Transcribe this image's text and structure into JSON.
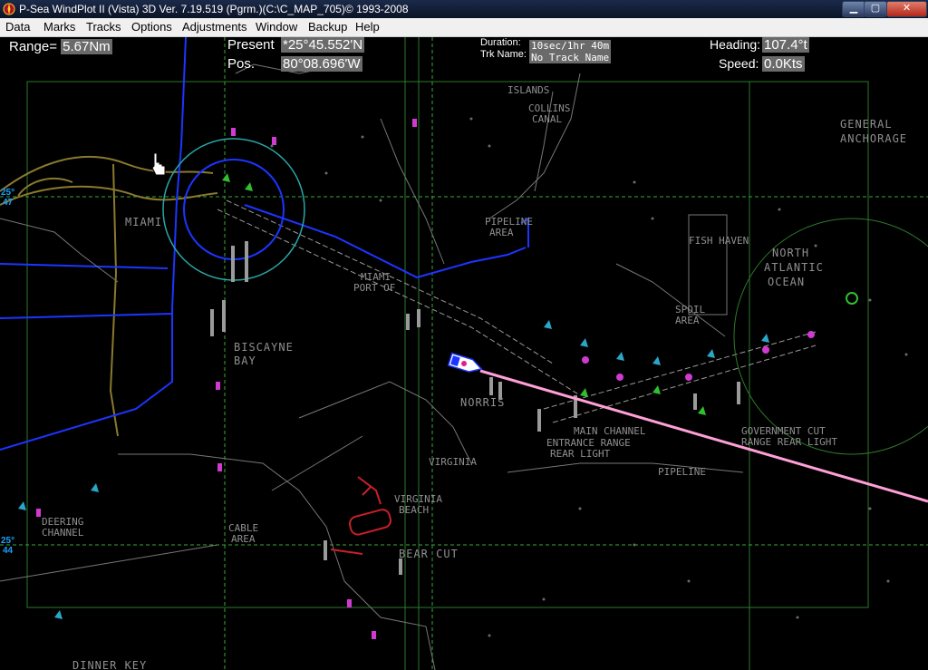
{
  "window": {
    "title": "P-Sea WindPlot II (Vista)  3D Ver. 7.19.519 (Pgrm.)(C:\\C_MAP_705)© 1993-2008"
  },
  "menu": [
    "Data",
    "Marks",
    "Tracks",
    "Options",
    "Adjustments",
    "Window",
    "Backup",
    "Help"
  ],
  "hud": {
    "range_label": "Range=",
    "range_value": "5.67Nm",
    "present_label": "Present",
    "lat": "*25°45.552'N",
    "pos_label": "Pos.",
    "lon": "80°08.696'W",
    "duration_label": "Duration:",
    "duration_value": "10sec/1hr 40m",
    "trk_label": "Trk Name:",
    "trk_value": "No Track Name",
    "heading_label": "Heading:",
    "heading_value": "107.4°t",
    "speed_label": "Speed:",
    "speed_value": "0.0Kts"
  },
  "grid_labels": {
    "lat1a": "25°",
    "lat1b": "47",
    "lat2a": "25°",
    "lat2b": "44"
  },
  "places": {
    "miami": "MIAMI",
    "miami_port": "MIAMI",
    "port_of": "PORT OF",
    "biscayne": "BISCAYNE",
    "bay": "BAY",
    "north": "NORTH",
    "atlantic": "ATLANTIC",
    "ocean": "OCEAN",
    "general": "GENERAL",
    "anchorage": "ANCHORAGE",
    "bear_cut": "BEAR CUT",
    "dinner_key": "DINNER KEY",
    "pipeline_area": "PIPELINE",
    "area": "AREA",
    "fish_haven": "FISH HAVEN",
    "main_channel": "MAIN CHANNEL",
    "entrance_range": "ENTRANCE RANGE",
    "rear_light": "REAR LIGHT",
    "pipeline": "PIPELINE",
    "collins": "COLLINS",
    "canal": "CANAL",
    "norris": "NORRIS",
    "virginia": "VIRGINIA",
    "government_cut": "GOVERNMENT CUT",
    "range_rear_light": "RANGE REAR LIGHT",
    "spoil_area": "SPOIL",
    "spoil_area2": "AREA",
    "islands": "ISLANDS",
    "virginia_beach": "VIRGINIA",
    "beach": "BEACH",
    "cable_area": "CABLE",
    "cable_area2": "AREA",
    "deering": "DEERING",
    "channel": "CHANNEL"
  },
  "colors": {
    "track_line": "#ff9fd8",
    "blue_route": "#1c35ff",
    "grid_dash": "#2e7d2e",
    "highway": "#8a7a2e",
    "vessel": "#ffffff"
  },
  "icons": {
    "app": "compass-rose-icon",
    "cursor": "hand-cursor-icon",
    "vessel": "vessel-icon"
  }
}
